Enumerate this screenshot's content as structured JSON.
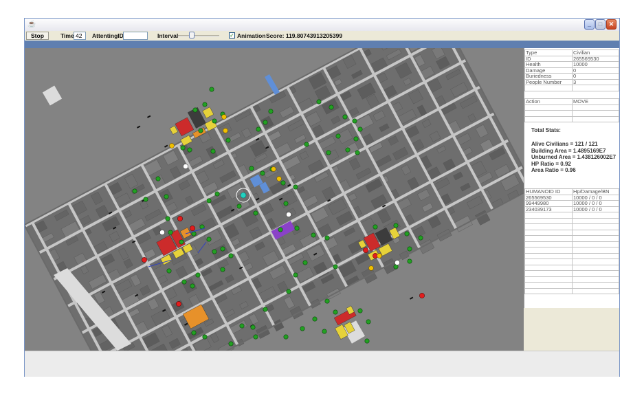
{
  "window": {
    "controls": [
      "minimize",
      "maximize",
      "close"
    ],
    "icon": "java-cup-icon"
  },
  "toolbar": {
    "stop_label": "Stop",
    "time_label": "Time",
    "time_value": "42",
    "attending_label": "AttentingID",
    "attending_value": "",
    "interval_label": "Interval",
    "interval_fraction": 0.3,
    "animation_checked": true,
    "animation_label": "Animation",
    "score_label": "Score: 119.80743913205399"
  },
  "agent_info": [
    {
      "key": "Type",
      "value": "Civilian"
    },
    {
      "key": "ID",
      "value": "265569530"
    },
    {
      "key": "Health",
      "value": "10000"
    },
    {
      "key": "Damage",
      "value": "0"
    },
    {
      "key": "Buriedness",
      "value": "0"
    },
    {
      "key": "People Number",
      "value": "3"
    }
  ],
  "action": {
    "key": "Action",
    "value": "MOVE"
  },
  "stats": {
    "title": "Total Stats:",
    "lines": [
      "Alive Civilians = 121 / 121",
      "Building Area = 1.4895169E7",
      "Unburned Area = 1.438126002E7",
      "HP Ratio = 0.92",
      "Area Ratio = 0.96"
    ]
  },
  "humanoid_table": {
    "headers": [
      "HUMANOID ID",
      "Hp/Damage/BN"
    ],
    "rows": [
      [
        "265569530",
        "10000 / 0 / 0"
      ],
      [
        "99449980",
        "10000 / 0 / 0"
      ],
      [
        "234039173",
        "10000 / 0 / 0"
      ]
    ],
    "empty_rows": 14
  },
  "map": {
    "background": "#838383",
    "colors": {
      "road": "#c6c6c6",
      "building": "#6e6e6e",
      "civilian": "#22a022",
      "fire_light": "#e6d23a",
      "fire_medium": "#e7912a",
      "fire_heavy": "#cc2b2b",
      "burnt": "#3c3c3c",
      "refuge": "#8a42c8",
      "police": "#5f8fd8",
      "ambulance": "#22d2c0",
      "road_blockade": "#111111",
      "fire_brigade": "#e21d1d",
      "ambulance_team": "#ffffff",
      "police_force": "#f0c000"
    }
  }
}
